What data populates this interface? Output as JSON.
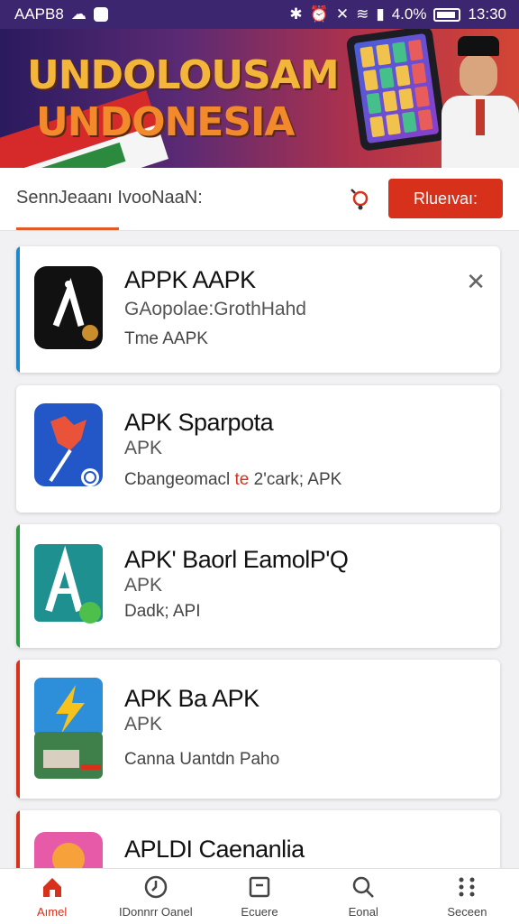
{
  "status_bar": {
    "app_name": "AAPB8",
    "battery_percent": "4.0%",
    "time": "13:30",
    "icons": [
      "notification-icon",
      "bluetooth-icon",
      "alarm-icon",
      "mute-icon",
      "wifi-icon",
      "signal-icon",
      "battery-icon"
    ]
  },
  "banner": {
    "line1": "UNDOLOUSAM",
    "line2": "UNDONESIA"
  },
  "search": {
    "text": "SennJeaanı IvooNaaN:",
    "button_label": "Rlueıvaı:",
    "icon": "pin-icon"
  },
  "apps": [
    {
      "title": "APPK AAPK",
      "subtitle": "GAopolae:GrothHahd",
      "desc": "Tme AAPK",
      "accent": "#1e88c9",
      "icon": "black-a-logo-icon",
      "closable": true
    },
    {
      "title": "APK Sparpota",
      "subtitle": "APK",
      "desc_pre": "Cbangeomacl ",
      "desc_hl": "te",
      "desc_post": " 2'cark; APK",
      "accent": "",
      "icon": "red-leaf-logo-icon"
    },
    {
      "title": "APK' Baorl EamolP'Q",
      "subtitle": "APK",
      "desc": "Dadk; API",
      "accent": "#2f9a44",
      "icon": "teal-a-logo-icon"
    },
    {
      "title": "APK Ba APK",
      "subtitle": "APK",
      "desc": "Canna Uantdn Paho",
      "accent": "#d8311b",
      "icon": "lightning-logo-icon"
    },
    {
      "title": "APLDI Caenanlia",
      "subtitle": "",
      "desc": "",
      "accent": "#d8311b",
      "icon": "pink-logo-icon"
    }
  ],
  "bottom_nav": [
    {
      "label": "Aımel",
      "icon": "home-icon",
      "active": true
    },
    {
      "label": "IDonnrr Oanel",
      "icon": "clock-icon",
      "active": false
    },
    {
      "label": "Ecuere",
      "icon": "square-icon",
      "active": false
    },
    {
      "label": "Eonal",
      "icon": "search-icon",
      "active": false
    },
    {
      "label": "Seceen",
      "icon": "grid-icon",
      "active": false
    }
  ],
  "colors": {
    "status_bar": "#3c2670",
    "accent_red": "#d8311b",
    "card_bg": "#ffffff",
    "page_bg": "#f1f1f3"
  }
}
